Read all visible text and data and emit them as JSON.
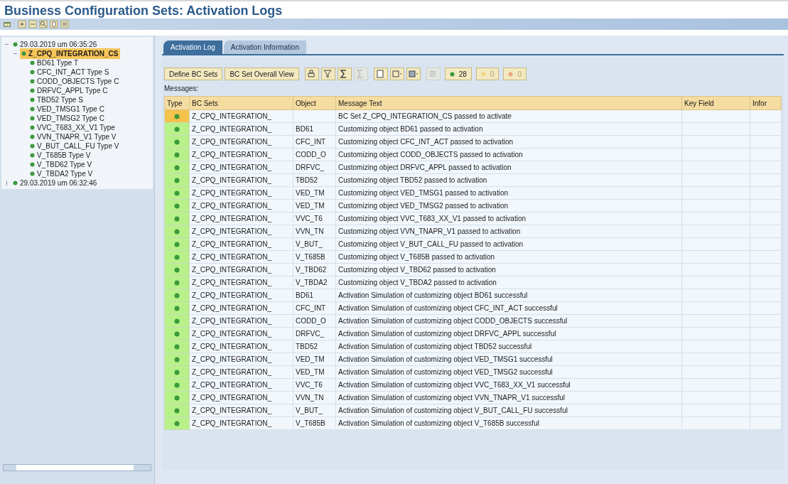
{
  "window": {
    "title": "Business Configuration Sets: Activation Logs"
  },
  "toolbar": {
    "icons": [
      {
        "kind": "display"
      },
      {
        "kind": "expand"
      },
      {
        "kind": "collapse"
      },
      {
        "kind": "find"
      },
      {
        "kind": "doc"
      },
      {
        "kind": "settings"
      }
    ]
  },
  "tree": [
    {
      "label": "29.03.2019 um 06:35:26",
      "expanded": true,
      "selected": false,
      "children": [
        {
          "label": "Z_CPQ_INTEGRATION_CS",
          "expanded": true,
          "selected": true,
          "children": [
            {
              "label": "BD61 Type T",
              "selected": false
            },
            {
              "label": "CFC_INT_ACT Type S",
              "selected": false
            },
            {
              "label": "CODD_OBJECTS Type C",
              "selected": false
            },
            {
              "label": "DRFVC_APPL Type C",
              "selected": false
            },
            {
              "label": "TBD52 Type S",
              "selected": false
            },
            {
              "label": "VED_TMSG1 Type C",
              "selected": false
            },
            {
              "label": "VED_TMSG2 Type C",
              "selected": false
            },
            {
              "label": "VVC_T683_XX_V1 Type",
              "selected": false
            },
            {
              "label": "VVN_TNAPR_V1 Type V",
              "selected": false
            },
            {
              "label": "V_BUT_CALL_FU Type V",
              "selected": false
            },
            {
              "label": "V_T685B Type V",
              "selected": false
            },
            {
              "label": "V_TBD62 Type V",
              "selected": false
            },
            {
              "label": "V_TBDA2 Type V",
              "selected": false
            }
          ]
        }
      ]
    },
    {
      "label": "29.03.2019 um 06:32:46",
      "expanded": false,
      "selected": false
    }
  ],
  "tabs": [
    {
      "label": "Activation Log",
      "selected": true
    },
    {
      "label": "Activation Information",
      "selected": false
    }
  ],
  "buttons": [
    "Define BC Sets",
    "BC Set Overall View"
  ],
  "grid_tools": [
    {
      "kind": "print",
      "disabled": false
    },
    {
      "kind": "filter",
      "disabled": false
    },
    {
      "kind": "sum",
      "disabled": false
    },
    {
      "kind": "subtotal",
      "disabled": true
    },
    {
      "kind": "doc",
      "disabled": false
    },
    {
      "kind": "export",
      "disabled": false
    },
    {
      "kind": "layout",
      "disabled": false
    },
    {
      "kind": "disabled-count",
      "disabled": true
    }
  ],
  "counters": [
    {
      "kind": "success",
      "count": "28"
    },
    {
      "kind": "warning",
      "count": "0"
    },
    {
      "kind": "error",
      "count": "0"
    }
  ],
  "messages_label": "Messages:",
  "table": {
    "columns": [
      "Type",
      "BC Sets",
      "Object",
      "Message Text",
      "Key Field",
      "Infor"
    ],
    "rows": [
      {
        "kind": "success",
        "selected": true,
        "bc_set": "Z_CPQ_INTEGRATION_",
        "message": "BC Set Z_CPQ_INTEGRATION_CS passed to activate"
      },
      {
        "kind": "success",
        "selected": false,
        "bc_set": "Z_CPQ_INTEGRATION_",
        "object": "BD61",
        "message": "Customizing object BD61 passed to activation"
      },
      {
        "kind": "success",
        "selected": false,
        "bc_set": "Z_CPQ_INTEGRATION_",
        "object": "CFC_INT",
        "message": "Customizing object CFC_INT_ACT passed to activation"
      },
      {
        "kind": "success",
        "selected": false,
        "bc_set": "Z_CPQ_INTEGRATION_",
        "object": "CODD_O",
        "message": "Customizing object CODD_OBJECTS passed to activation"
      },
      {
        "kind": "success",
        "selected": false,
        "bc_set": "Z_CPQ_INTEGRATION_",
        "object": "DRFVC_",
        "message": "Customizing object DRFVC_APPL passed to activation"
      },
      {
        "kind": "success",
        "selected": false,
        "bc_set": "Z_CPQ_INTEGRATION_",
        "object": "TBD52",
        "message": "Customizing object TBD52 passed to activation"
      },
      {
        "kind": "success",
        "selected": false,
        "bc_set": "Z_CPQ_INTEGRATION_",
        "object": "VED_TM",
        "message": "Customizing object VED_TMSG1 passed to activation"
      },
      {
        "kind": "success",
        "selected": false,
        "bc_set": "Z_CPQ_INTEGRATION_",
        "object": "VED_TM",
        "message": "Customizing object VED_TMSG2 passed to activation"
      },
      {
        "kind": "success",
        "selected": false,
        "bc_set": "Z_CPQ_INTEGRATION_",
        "object": "VVC_T6",
        "message": "Customizing object VVC_T683_XX_V1 passed to activation"
      },
      {
        "kind": "success",
        "selected": false,
        "bc_set": "Z_CPQ_INTEGRATION_",
        "object": "VVN_TN",
        "message": "Customizing object VVN_TNAPR_V1 passed to activation"
      },
      {
        "kind": "success",
        "selected": false,
        "bc_set": "Z_CPQ_INTEGRATION_",
        "object": "V_BUT_",
        "message": "Customizing object V_BUT_CALL_FU passed to activation"
      },
      {
        "kind": "success",
        "selected": false,
        "bc_set": "Z_CPQ_INTEGRATION_",
        "object": "V_T685B",
        "message": "Customizing object V_T685B passed to activation"
      },
      {
        "kind": "success",
        "selected": false,
        "bc_set": "Z_CPQ_INTEGRATION_",
        "object": "V_TBD62",
        "message": "Customizing object V_TBD62 passed to activation"
      },
      {
        "kind": "success",
        "selected": false,
        "bc_set": "Z_CPQ_INTEGRATION_",
        "object": "V_TBDA2",
        "message": "Customizing object V_TBDA2 passed to activation"
      },
      {
        "kind": "success",
        "selected": false,
        "bc_set": "Z_CPQ_INTEGRATION_",
        "object": "BD61",
        "message": "Activation Simulation of customizing object BD61 successful"
      },
      {
        "kind": "success",
        "selected": false,
        "bc_set": "Z_CPQ_INTEGRATION_",
        "object": "CFC_INT",
        "message": "Activation Simulation of customizing object CFC_INT_ACT successful"
      },
      {
        "kind": "success",
        "selected": false,
        "bc_set": "Z_CPQ_INTEGRATION_",
        "object": "CODD_O",
        "message": "Activation Simulation of customizing object CODD_OBJECTS successful"
      },
      {
        "kind": "success",
        "selected": false,
        "bc_set": "Z_CPQ_INTEGRATION_",
        "object": "DRFVC_",
        "message": "Activation Simulation of customizing object DRFVC_APPL successful"
      },
      {
        "kind": "success",
        "selected": false,
        "bc_set": "Z_CPQ_INTEGRATION_",
        "object": "TBD52",
        "message": "Activation Simulation of customizing object TBD52 successful"
      },
      {
        "kind": "success",
        "selected": false,
        "bc_set": "Z_CPQ_INTEGRATION_",
        "object": "VED_TM",
        "message": "Activation Simulation of customizing object VED_TMSG1 successful"
      },
      {
        "kind": "success",
        "selected": false,
        "bc_set": "Z_CPQ_INTEGRATION_",
        "object": "VED_TM",
        "message": "Activation Simulation of customizing object VED_TMSG2 successful"
      },
      {
        "kind": "success",
        "selected": false,
        "bc_set": "Z_CPQ_INTEGRATION_",
        "object": "VVC_T6",
        "message": "Activation Simulation of customizing object VVC_T683_XX_V1 successful"
      },
      {
        "kind": "success",
        "selected": false,
        "bc_set": "Z_CPQ_INTEGRATION_",
        "object": "VVN_TN",
        "message": "Activation Simulation of customizing object VVN_TNAPR_V1 successful"
      },
      {
        "kind": "success",
        "selected": false,
        "bc_set": "Z_CPQ_INTEGRATION_",
        "object": "V_BUT_",
        "message": "Activation Simulation of customizing object V_BUT_CALL_FU successful"
      },
      {
        "kind": "success",
        "selected": false,
        "bc_set": "Z_CPQ_INTEGRATION_",
        "object": "V_T685B",
        "message": "Activation Simulation of customizing object V_T685B successful"
      }
    ]
  }
}
